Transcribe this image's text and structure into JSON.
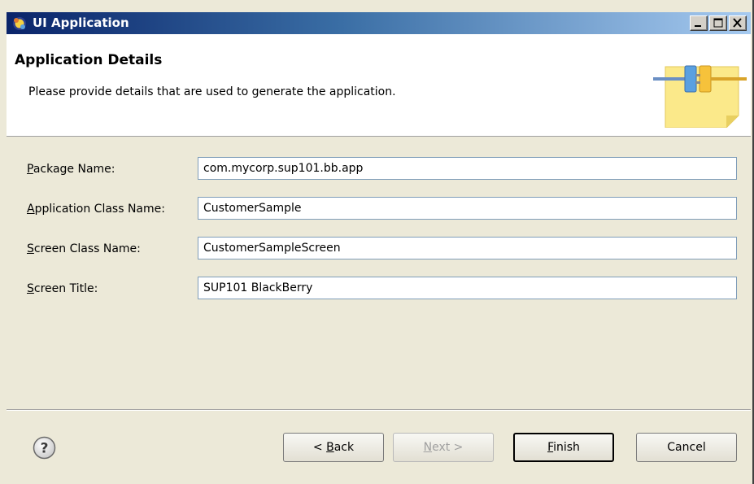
{
  "window": {
    "title": "UI Application",
    "icon": "eclipse-app-icon",
    "controls": [
      "minimize-icon",
      "maximize-icon",
      "close-icon"
    ]
  },
  "banner": {
    "title": "Application Details",
    "description": "Please provide details that are used to generate the application.",
    "graphic": "plug-connector-icon"
  },
  "form": {
    "fields": [
      {
        "label_mnemonic": "P",
        "label_rest": "ackage Name:",
        "value": "com.mycorp.sup101.bb.app"
      },
      {
        "label_mnemonic": "A",
        "label_rest": "pplication Class Name:",
        "value": "CustomerSample"
      },
      {
        "label_mnemonic": "S",
        "label_rest": "creen Class Name:",
        "value": "CustomerSampleScreen"
      },
      {
        "label_mnemonic": "S",
        "label_rest": "creen Title:",
        "value": "SUP101 BlackBerry"
      }
    ]
  },
  "buttons": {
    "help_icon": "help-icon",
    "back": {
      "prefix": "< ",
      "mnemonic": "B",
      "rest": "ack",
      "enabled": true
    },
    "next": {
      "mnemonic": "N",
      "rest": "ext >",
      "enabled": false
    },
    "finish": {
      "mnemonic": "F",
      "rest": "inish",
      "enabled": true,
      "default": true
    },
    "cancel": {
      "label": "Cancel",
      "enabled": true
    }
  },
  "colors": {
    "titlebar_start": "#0a246a",
    "titlebar_end": "#a6caf0",
    "dialog_background": "#ece9d8",
    "input_border": "#7f9db9",
    "disabled_text": "#a0a0a0"
  }
}
